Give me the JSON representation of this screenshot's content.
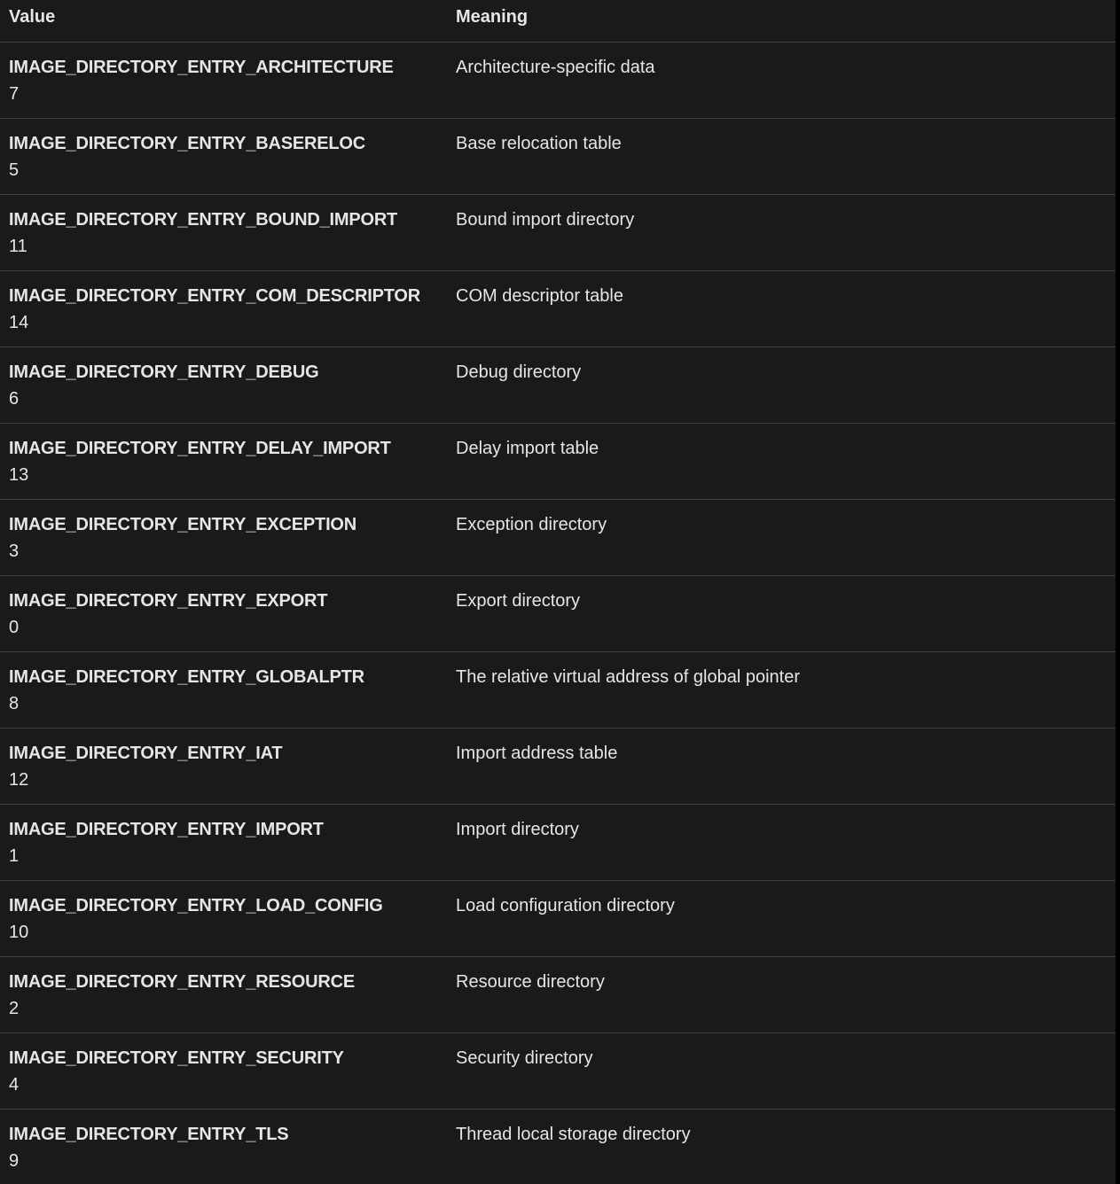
{
  "table": {
    "headers": {
      "value": "Value",
      "meaning": "Meaning"
    },
    "rows": [
      {
        "name": "IMAGE_DIRECTORY_ENTRY_ARCHITECTURE",
        "number": "7",
        "meaning": "Architecture-specific data"
      },
      {
        "name": "IMAGE_DIRECTORY_ENTRY_BASERELOC",
        "number": "5",
        "meaning": "Base relocation table"
      },
      {
        "name": "IMAGE_DIRECTORY_ENTRY_BOUND_IMPORT",
        "number": "11",
        "meaning": "Bound import directory"
      },
      {
        "name": "IMAGE_DIRECTORY_ENTRY_COM_DESCRIPTOR",
        "number": "14",
        "meaning": "COM descriptor table"
      },
      {
        "name": "IMAGE_DIRECTORY_ENTRY_DEBUG",
        "number": "6",
        "meaning": "Debug directory"
      },
      {
        "name": "IMAGE_DIRECTORY_ENTRY_DELAY_IMPORT",
        "number": "13",
        "meaning": "Delay import table"
      },
      {
        "name": "IMAGE_DIRECTORY_ENTRY_EXCEPTION",
        "number": "3",
        "meaning": "Exception directory"
      },
      {
        "name": "IMAGE_DIRECTORY_ENTRY_EXPORT",
        "number": "0",
        "meaning": "Export directory"
      },
      {
        "name": "IMAGE_DIRECTORY_ENTRY_GLOBALPTR",
        "number": "8",
        "meaning": "The relative virtual address of global pointer"
      },
      {
        "name": "IMAGE_DIRECTORY_ENTRY_IAT",
        "number": "12",
        "meaning": "Import address table"
      },
      {
        "name": "IMAGE_DIRECTORY_ENTRY_IMPORT",
        "number": "1",
        "meaning": "Import directory"
      },
      {
        "name": "IMAGE_DIRECTORY_ENTRY_LOAD_CONFIG",
        "number": "10",
        "meaning": "Load configuration directory"
      },
      {
        "name": "IMAGE_DIRECTORY_ENTRY_RESOURCE",
        "number": "2",
        "meaning": "Resource directory"
      },
      {
        "name": "IMAGE_DIRECTORY_ENTRY_SECURITY",
        "number": "4",
        "meaning": "Security directory"
      },
      {
        "name": "IMAGE_DIRECTORY_ENTRY_TLS",
        "number": "9",
        "meaning": "Thread local storage directory"
      }
    ]
  }
}
